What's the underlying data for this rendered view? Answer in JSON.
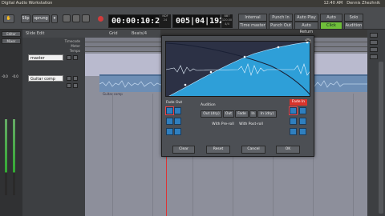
{
  "window": {
    "title": "Digital Audio Workstation"
  },
  "tray": {
    "time": "12:40 AM",
    "user": "Dennis Zhezhnik"
  },
  "toolbar": {
    "slide_mode": "Slip",
    "sync_label": "sprung",
    "main_clock": "00:00:10:27",
    "secondary_clock": "005|04|1920",
    "main_clock_meta": [
      "NDF",
      "24"
    ],
    "secondary_clock_meta": [
      "BBT",
      "120.00",
      "4/4"
    ],
    "buttons": {
      "internal": "Internal",
      "time_master": "Time master",
      "punch_in": "Punch In",
      "punch_out": "Punch Out",
      "auto_play": "Auto Play",
      "auto_return": "Auto Return",
      "auto_input": "Auto Input",
      "click": "Click",
      "solo": "Solo",
      "audition": "Audition"
    }
  },
  "toolbar2": {
    "edit_mode": "Slide Edit",
    "grid": "Grid",
    "snap": "Beats/4"
  },
  "left_strip": {
    "editor_btn": "Editor",
    "mixer_btn": "Mixer",
    "level": "-0.0",
    "gain": "-0.0"
  },
  "rulers": [
    "Timecode",
    "Meter",
    "Tempo"
  ],
  "tracks": [
    {
      "name": "master"
    },
    {
      "name": "Guitar comp"
    }
  ],
  "region": {
    "name": "Guitar comp"
  },
  "fade_editor": {
    "fade_out_label": "Fade Out",
    "fade_in_label": "Fade In",
    "audition_label": "Audition",
    "audition_buttons": [
      "Out (dry)",
      "Out",
      "Fade",
      "In",
      "In (dry)"
    ],
    "with_pre_roll": "With Pre-roll",
    "with_post_roll": "With Post-roll",
    "footer_buttons": [
      "Clear",
      "Reset",
      "Cancel",
      "OK"
    ]
  },
  "colors": {
    "fade_fill": "#2e9fd8",
    "fade_in_accent": "#d8342c",
    "record": "#d03c3c",
    "click_green": "#6fbf3a"
  }
}
